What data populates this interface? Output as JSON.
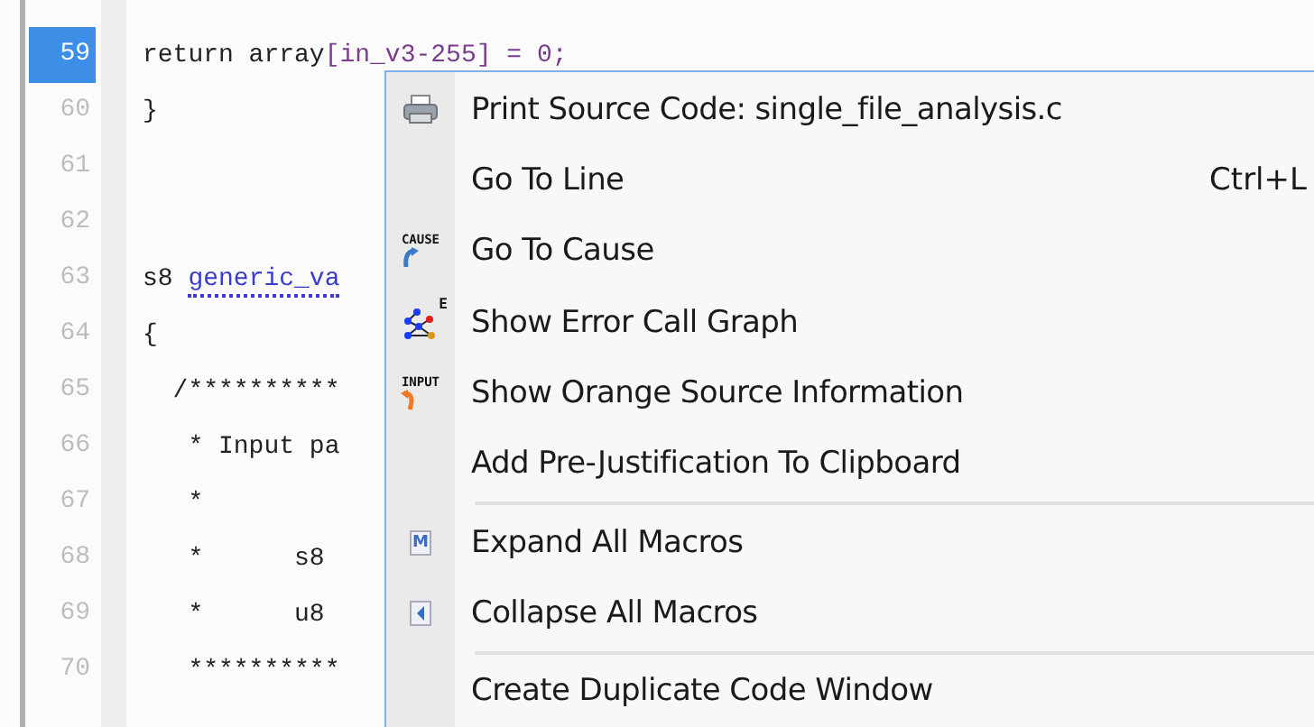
{
  "editor": {
    "lines": [
      {
        "number": "59",
        "selected": true,
        "segments": [
          {
            "text": "return array",
            "kind": "plain"
          },
          {
            "text": "[in_v3-255] = 0;",
            "kind": "marked"
          }
        ]
      },
      {
        "number": "60",
        "selected": false,
        "segments": [
          {
            "text": "}",
            "kind": "plain"
          }
        ]
      },
      {
        "number": "61",
        "selected": false
      },
      {
        "number": "62",
        "selected": false
      },
      {
        "number": "63",
        "selected": false,
        "segments": [
          {
            "text": "s8 ",
            "kind": "plain"
          },
          {
            "text": "generic_va",
            "kind": "link"
          }
        ]
      },
      {
        "number": "64",
        "selected": false,
        "segments": [
          {
            "text": "{",
            "kind": "plain"
          }
        ]
      },
      {
        "number": "65",
        "selected": false,
        "segments": [
          {
            "text": "  /**********",
            "kind": "plain"
          }
        ]
      },
      {
        "number": "66",
        "selected": false,
        "segments": [
          {
            "text": "   * Input pa",
            "kind": "plain"
          }
        ]
      },
      {
        "number": "67",
        "selected": false,
        "segments": [
          {
            "text": "   *",
            "kind": "plain"
          }
        ]
      },
      {
        "number": "68",
        "selected": false,
        "segments": [
          {
            "text": "   *      s8",
            "kind": "plain"
          }
        ]
      },
      {
        "number": "69",
        "selected": false,
        "segments": [
          {
            "text": "   *      u8",
            "kind": "plain"
          }
        ]
      },
      {
        "number": "70",
        "selected": false,
        "segments": [
          {
            "text": "   **********",
            "kind": "plain"
          }
        ]
      }
    ]
  },
  "context_menu": {
    "items": [
      {
        "kind": "printer",
        "label": "Print Source Code: single_file_analysis.c"
      },
      {
        "kind": "plain",
        "label": "Go To Line",
        "shortcut": "Ctrl+L"
      },
      {
        "kind": "cause",
        "label": "Go To Cause",
        "icon_text": "CAUSE"
      },
      {
        "kind": "graph",
        "label": "Show Error Call Graph",
        "icon_text": "E"
      },
      {
        "kind": "input",
        "label": "Show Orange Source Information",
        "icon_text": "INPUT"
      },
      {
        "kind": "plain",
        "label": "Add Pre-Justification To Clipboard"
      },
      {
        "kind": "separator"
      },
      {
        "kind": "macro",
        "label": "Expand All Macros",
        "icon_text": "M"
      },
      {
        "kind": "collapse",
        "label": "Collapse All Macros"
      },
      {
        "kind": "separator"
      },
      {
        "kind": "plain",
        "label": "Create Duplicate Code Window"
      }
    ]
  }
}
